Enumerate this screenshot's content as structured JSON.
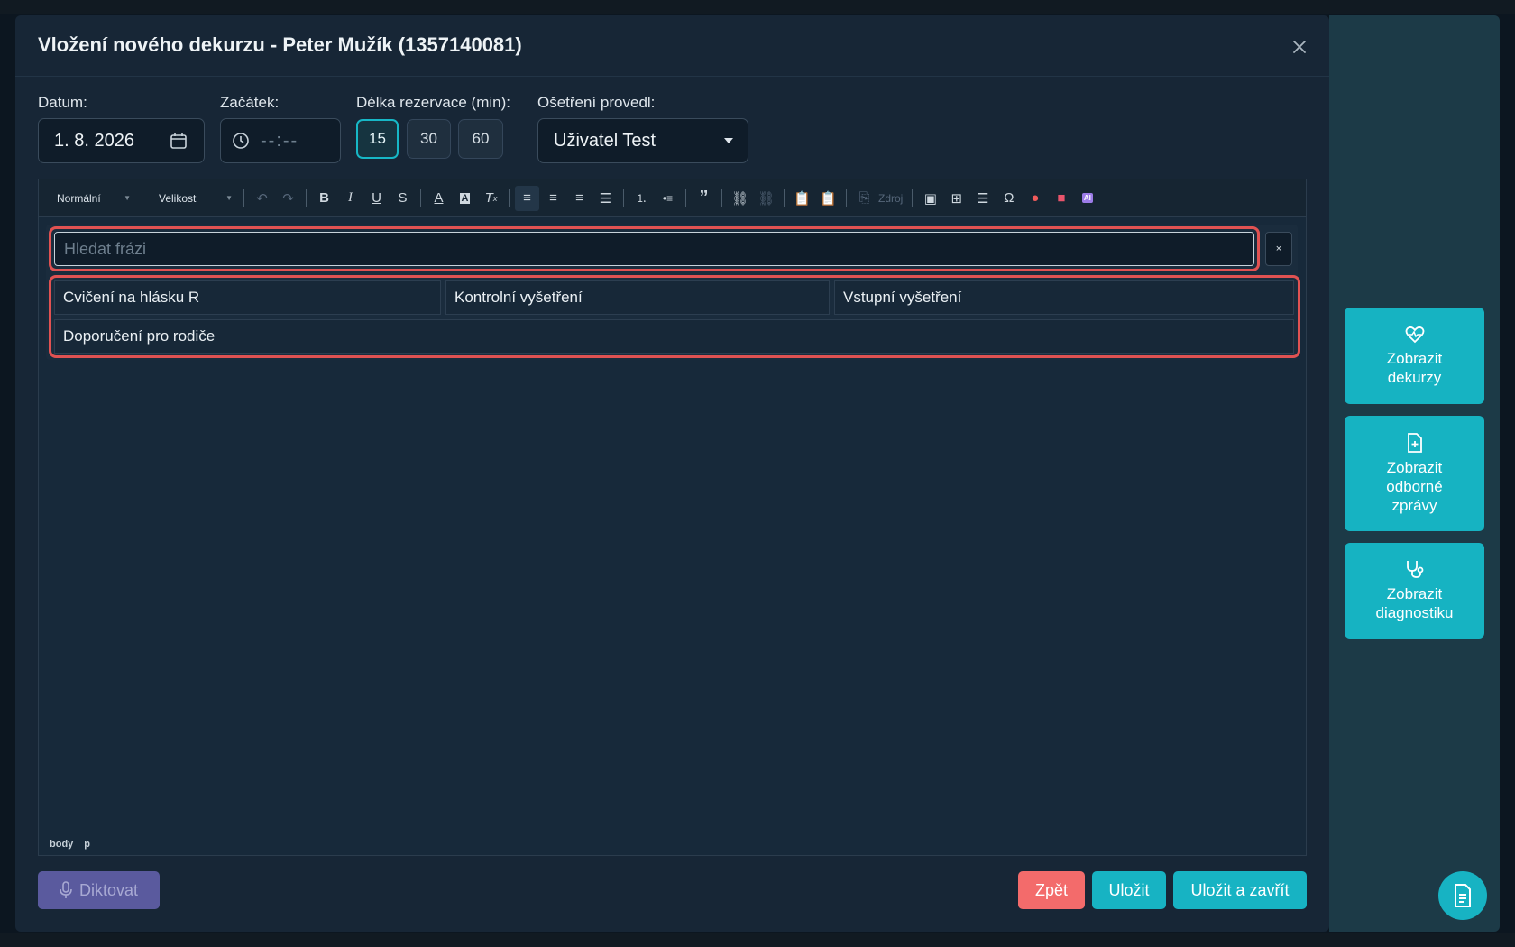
{
  "modal": {
    "title": "Vložení nového dekurzu - Peter Mužík (1357140081)"
  },
  "form": {
    "date_label": "Datum:",
    "date_value": "1. 8. 2026",
    "start_label": "Začátek:",
    "start_placeholder": "--:--",
    "length_label": "Délka rezervace (min):",
    "length_options": [
      "15",
      "30",
      "60"
    ],
    "length_selected": "15",
    "provider_label": "Ošetření provedl:",
    "provider_value": "Uživatel Test"
  },
  "toolbar": {
    "format_value": "Normální",
    "size_value": "Velikost",
    "source_label": "Zdroj"
  },
  "phrases": {
    "search_placeholder": "Hledat frázi",
    "clear_label": "×",
    "items": [
      "Cvičení na hlásku R",
      "Kontrolní vyšetření",
      "Vstupní vyšetření",
      "Doporučení pro rodiče"
    ]
  },
  "statusbar": {
    "path": [
      "body",
      "p"
    ]
  },
  "footer": {
    "dictate_label": "Diktovat",
    "back_label": "Zpět",
    "save_label": "Uložit",
    "save_close_label": "Uložit a zavřít"
  },
  "side": {
    "cards": [
      {
        "label": "Zobrazit\ndekurzy",
        "icon": "heart-pulse-icon"
      },
      {
        "label": "Zobrazit\nodborné\nzprávy",
        "icon": "file-plus-icon"
      },
      {
        "label": "Zobrazit\ndiagnostiku",
        "icon": "stethoscope-icon"
      }
    ]
  },
  "colors": {
    "accent": "#17b3c3",
    "danger": "#f36b6b",
    "highlight": "#e05252"
  }
}
